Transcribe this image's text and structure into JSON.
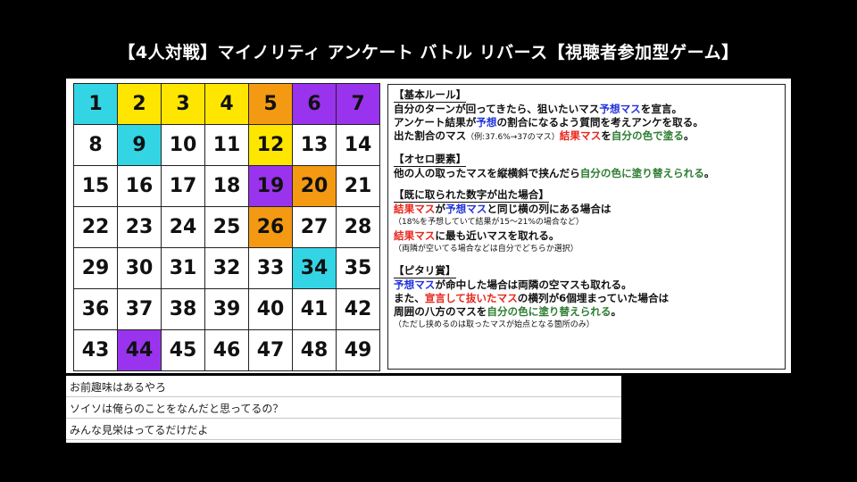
{
  "title": "【4人対戦】マイノリティ アンケート バトル リバース【視聴者参加型ゲーム】",
  "board": {
    "colors": {
      "cyan": "#33d5e5",
      "yellow": "#ffe600",
      "orange": "#f49a12",
      "purple": "#9933ee",
      "white": "#ffffff"
    },
    "cells": [
      {
        "n": "1",
        "c": "cyan"
      },
      {
        "n": "2",
        "c": "yellow"
      },
      {
        "n": "3",
        "c": "yellow"
      },
      {
        "n": "4",
        "c": "yellow"
      },
      {
        "n": "5",
        "c": "orange"
      },
      {
        "n": "6",
        "c": "purple"
      },
      {
        "n": "7",
        "c": "purple"
      },
      {
        "n": "8",
        "c": "white"
      },
      {
        "n": "9",
        "c": "cyan"
      },
      {
        "n": "10",
        "c": "white"
      },
      {
        "n": "11",
        "c": "white"
      },
      {
        "n": "12",
        "c": "yellow"
      },
      {
        "n": "13",
        "c": "white"
      },
      {
        "n": "14",
        "c": "white"
      },
      {
        "n": "15",
        "c": "white"
      },
      {
        "n": "16",
        "c": "white"
      },
      {
        "n": "17",
        "c": "white"
      },
      {
        "n": "18",
        "c": "white"
      },
      {
        "n": "19",
        "c": "purple"
      },
      {
        "n": "20",
        "c": "orange"
      },
      {
        "n": "21",
        "c": "white"
      },
      {
        "n": "22",
        "c": "white"
      },
      {
        "n": "23",
        "c": "white"
      },
      {
        "n": "24",
        "c": "white"
      },
      {
        "n": "25",
        "c": "white"
      },
      {
        "n": "26",
        "c": "orange"
      },
      {
        "n": "27",
        "c": "white"
      },
      {
        "n": "28",
        "c": "white"
      },
      {
        "n": "29",
        "c": "white"
      },
      {
        "n": "30",
        "c": "white"
      },
      {
        "n": "31",
        "c": "white"
      },
      {
        "n": "32",
        "c": "white"
      },
      {
        "n": "33",
        "c": "white"
      },
      {
        "n": "34",
        "c": "cyan"
      },
      {
        "n": "35",
        "c": "white"
      },
      {
        "n": "36",
        "c": "white"
      },
      {
        "n": "37",
        "c": "white"
      },
      {
        "n": "38",
        "c": "white"
      },
      {
        "n": "39",
        "c": "white"
      },
      {
        "n": "40",
        "c": "white"
      },
      {
        "n": "41",
        "c": "white"
      },
      {
        "n": "42",
        "c": "white"
      },
      {
        "n": "43",
        "c": "white"
      },
      {
        "n": "44",
        "c": "purple"
      },
      {
        "n": "45",
        "c": "white"
      },
      {
        "n": "46",
        "c": "white"
      },
      {
        "n": "47",
        "c": "white"
      },
      {
        "n": "48",
        "c": "white"
      },
      {
        "n": "49",
        "c": "white"
      }
    ]
  },
  "rules": {
    "basic": {
      "head": "【基本ルール】",
      "l1": [
        "自分のターンが回ってきたら、狙いたいマス",
        "予想マス",
        "を宣言。"
      ],
      "l2": [
        "アンケート結果が",
        "予想",
        "の割合になるよう質問を考えアンケを取る。"
      ],
      "l3": [
        "出た割合のマス",
        "（例:37.6%→37のマス）",
        "結果マス",
        "を",
        "自分の色で塗る",
        "。"
      ]
    },
    "othello": {
      "head": "【オセロ要素】",
      "l1": [
        "他の人の取ったマスを縦横斜で挟んだら",
        "自分の色に塗り替えられる",
        "。"
      ]
    },
    "taken": {
      "head": "【既に取られた数字が出た場合】",
      "l1": [
        "結果マス",
        "が",
        "予想マス",
        "と同じ横の列にある場合は"
      ],
      "l2": "（18%を予想していて結果が15～21%の場合など）",
      "l3": [
        "結果マス",
        "に最も近いマスを取れる。"
      ],
      "l4": "（両隣が空いてる場合などは自分でどちらか選択）"
    },
    "exact": {
      "head": "【ピタリ賞】",
      "l1": [
        "予想マス",
        "が命中した場合は両隣の空マスも取れる。"
      ],
      "l2": [
        "また、",
        "宣言して抜いたマス",
        "の横列が6個埋まっていた場合は"
      ],
      "l3": [
        "周囲の八方のマスを",
        "自分の色に塗り替えられる",
        "。"
      ],
      "l4": "（ただし挟めるのは取ったマスが始点となる箇所のみ）"
    }
  },
  "chat": [
    "お前趣味はあるやろ",
    "ソイソは俺らのことをなんだと思ってるの？",
    "みんな見栄はってるだけだよ"
  ]
}
